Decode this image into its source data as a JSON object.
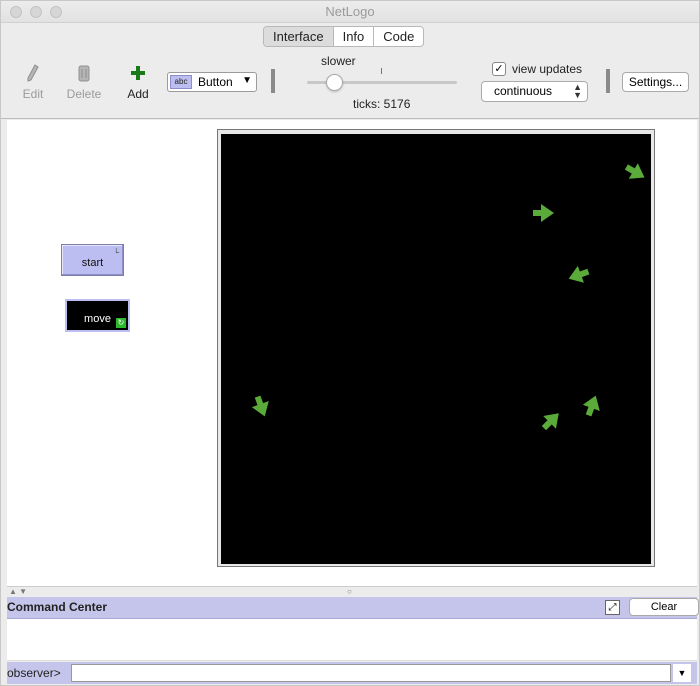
{
  "window": {
    "title": "NetLogo"
  },
  "tabs": [
    {
      "label": "Interface",
      "active": true
    },
    {
      "label": "Info",
      "active": false
    },
    {
      "label": "Code",
      "active": false
    }
  ],
  "toolbar": {
    "edit_label": "Edit",
    "delete_label": "Delete",
    "add_label": "Add",
    "widget_type": "Button",
    "speed_label": "slower",
    "ticks_label": "ticks: 5176",
    "view_updates_label": "view updates",
    "view_updates_checked": true,
    "update_mode": "continuous",
    "settings_label": "Settings..."
  },
  "widgets": {
    "start_label": "start",
    "move_label": "move"
  },
  "view": {
    "background": "#000000",
    "turtle_color": "#5aab3a",
    "turtle_count": 7
  },
  "command_center": {
    "title": "Command Center",
    "clear_label": "Clear",
    "prompt": "observer>",
    "input_value": ""
  },
  "colors": {
    "button_bg": "#bcbdf0",
    "command_center_bg": "#c5c5eb"
  }
}
